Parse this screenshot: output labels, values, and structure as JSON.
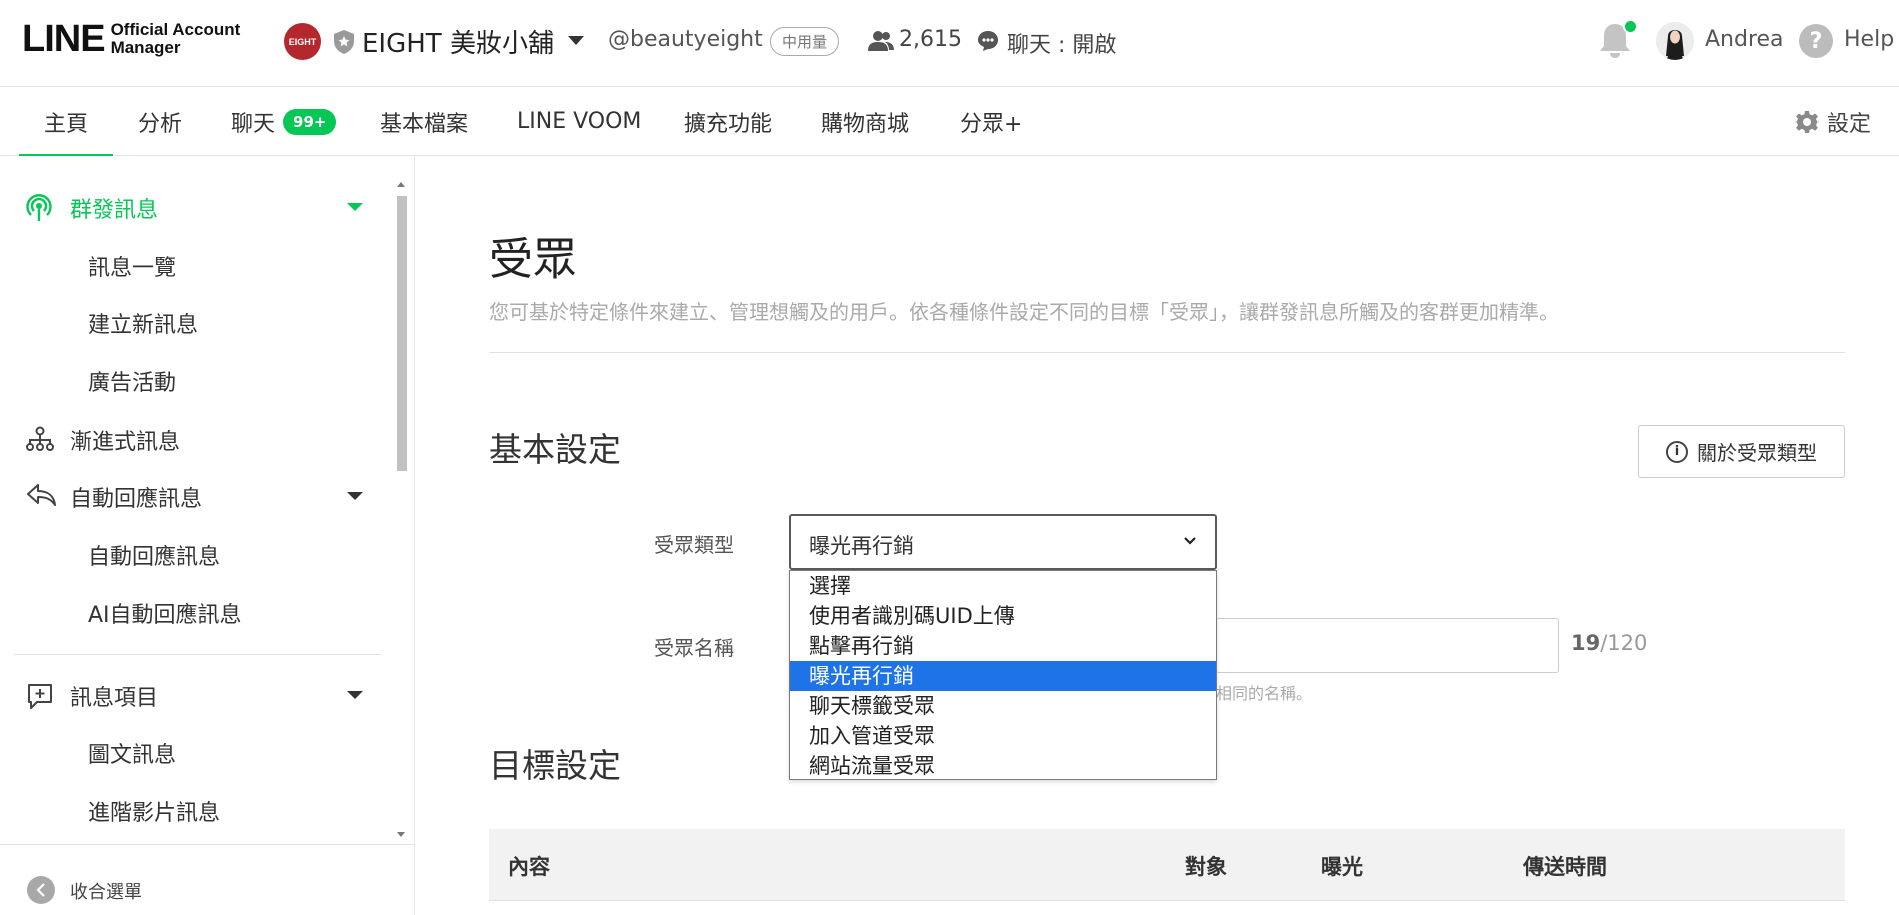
{
  "header": {
    "logo_main": "LINE",
    "logo_sub_line1": "Official Account",
    "logo_sub_line2": "Manager",
    "account_badge": "EIGHT",
    "account_name": "EIGHT 美妝小舖",
    "account_id": "@beautyeight",
    "plan": "中用量",
    "friends_count": "2,615",
    "chat_status": "聊天 : 開啟",
    "user_name": "Andrea",
    "help_label": "Help",
    "notification_dot_color": "#06c755"
  },
  "nav": {
    "tabs": [
      {
        "label": "主頁",
        "active": true
      },
      {
        "label": "分析"
      },
      {
        "label": "聊天",
        "badge": "99+"
      },
      {
        "label": "基本檔案"
      },
      {
        "label": "LINE VOOM"
      },
      {
        "label": "擴充功能"
      },
      {
        "label": "購物商城"
      },
      {
        "label": "分眾+"
      }
    ],
    "settings_label": "設定",
    "accent_color": "#06c755"
  },
  "sidebar": {
    "groups": [
      {
        "label": "群發訊息",
        "icon": "broadcast-icon",
        "active": true,
        "items": [
          "訊息一覽",
          "建立新訊息",
          "廣告活動"
        ]
      },
      {
        "label": "漸進式訊息",
        "icon": "hierarchy-icon"
      },
      {
        "label": "自動回應訊息",
        "icon": "reply-icon",
        "items": [
          "自動回應訊息",
          "AI自動回應訊息"
        ]
      },
      {
        "label": "訊息項目",
        "icon": "add-message-icon",
        "items": [
          "圖文訊息",
          "進階影片訊息"
        ]
      }
    ],
    "collapse_label": "收合選單"
  },
  "main": {
    "title": "受眾",
    "description": "您可基於特定條件來建立、管理想觸及的用戶。依各種條件設定不同的目標「受眾」，讓群發訊息所觸及的客群更加精準。",
    "basic_section": "基本設定",
    "about_button": "關於受眾類型",
    "type_label": "受眾類型",
    "type_value": "曝光再行銷",
    "type_options": [
      "選擇",
      "使用者識別碼UID上傳",
      "點擊再行銷",
      "曝光再行銷",
      "聊天標籤受眾",
      "加入管道受眾",
      "網站流量受眾"
    ],
    "type_selected_index": 3,
    "name_label": "受眾名稱",
    "name_counter_current": "19",
    "name_counter_max": "/120",
    "name_hint": "相同的名稱。",
    "target_section": "目標設定",
    "table_headers": [
      "內容",
      "對象",
      "曝光",
      "傳送時間"
    ]
  }
}
